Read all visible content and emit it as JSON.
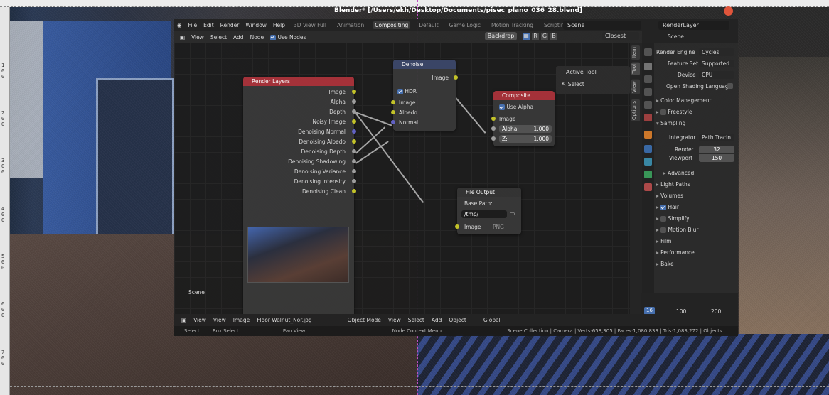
{
  "window_title": "Blender* [/Users/ekh/Desktop/Documents/pisec_plano_036_28.blend]",
  "top_menu": [
    "File",
    "Edit",
    "Render",
    "Window",
    "Help"
  ],
  "workspaces": [
    "3D View Full",
    "Animation",
    "Compositing",
    "Default",
    "Game Logic",
    "Motion Tracking",
    "Scripting"
  ],
  "active_workspace": "Compositing",
  "scene_name": "Scene",
  "render_layer": "RenderLayer",
  "node_header": {
    "view": "View",
    "select": "Select",
    "add": "Add",
    "node": "Node",
    "use_nodes": "Use Nodes",
    "backdrop": "Backdrop",
    "rgb": [
      "R",
      "G",
      "B"
    ],
    "filter": "Closest"
  },
  "nodes": {
    "render_layers": {
      "title": "Render Layers",
      "outputs": [
        "Image",
        "Alpha",
        "Depth",
        "Noisy Image",
        "Denoising Normal",
        "Denoising Albedo",
        "Denoising Depth",
        "Denoising Shadowing",
        "Denoising Variance",
        "Denoising Intensity",
        "Denoising Clean"
      ],
      "scene": "Scene"
    },
    "denoise": {
      "title": "Denoise",
      "output": "Image",
      "hdr": "HDR",
      "inputs": [
        "Image",
        "Albedo",
        "Normal"
      ]
    },
    "composite": {
      "title": "Composite",
      "use_alpha": "Use Alpha",
      "image": "Image",
      "alpha_label": "Alpha:",
      "alpha_value": "1.000",
      "z_label": "Z:",
      "z_value": "1.000"
    },
    "file_output": {
      "title": "File Output",
      "base_path_label": "Base Path:",
      "base_path": "/tmp/",
      "image": "Image",
      "format": "PNG"
    }
  },
  "side_tabs": [
    "Item",
    "Tool",
    "View",
    "Options"
  ],
  "active_tool": {
    "title": "Active Tool",
    "tool": "Select"
  },
  "properties": {
    "scene": "Scene",
    "render_engine_label": "Render Engine",
    "render_engine": "Cycles",
    "feature_set_label": "Feature Set",
    "feature_set": "Supported",
    "device_label": "Device",
    "device": "CPU",
    "osl": "Open Shading Language",
    "color_management": "Color Management",
    "freestyle": "Freestyle",
    "sampling": "Sampling",
    "integrator_label": "Integrator",
    "integrator": "Path Tracin",
    "render_label": "Render",
    "render_samples": "32",
    "viewport_label": "Viewport",
    "viewport_samples": "150",
    "advanced": "Advanced",
    "light_paths": "Light Paths",
    "volumes": "Volumes",
    "hair": "Hair",
    "simplify": "Simplify",
    "motion_blur": "Motion Blur",
    "film": "Film",
    "performance": "Performance",
    "bake": "Bake"
  },
  "bottom_bar": {
    "view": "View",
    "view2": "View",
    "image": "Image",
    "image_name": "Floor Walnut_Nor.jpg",
    "mode": "Object Mode",
    "view3": "View",
    "select": "Select",
    "add": "Add",
    "object": "Object",
    "orientation": "Global"
  },
  "status_bar": {
    "select": "Select",
    "box_select": "Box Select",
    "pan_view": "Pan View",
    "context_menu": "Node Context Menu",
    "stats": "Scene Collection | Camera | Verts:658,305 | Faces:1,080,833 | Tris:1,083,272 | Objects"
  },
  "timeline": {
    "current_frame": "16",
    "mark_100": "100",
    "mark_200": "200"
  },
  "ruler_marks": [
    "1",
    "0",
    "0",
    "2",
    "0",
    "0",
    "3",
    "0",
    "0",
    "4",
    "0",
    "0",
    "5",
    "0",
    "0",
    "6",
    "0",
    "0",
    "7",
    "0",
    "0"
  ],
  "colors": {
    "render_layers_header": "#a8323a",
    "composite_header": "#a8323a",
    "accent": "#4772b3"
  }
}
